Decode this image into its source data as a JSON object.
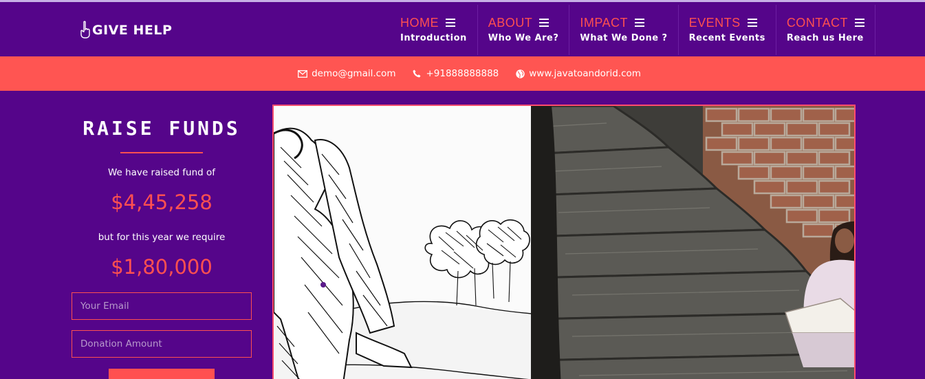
{
  "brand": {
    "name": "GIVE HELP",
    "icon": "hand-pointing-up-icon"
  },
  "nav": [
    {
      "label": "HOME",
      "sub": "Introduction"
    },
    {
      "label": "ABOUT",
      "sub": "Who We Are?"
    },
    {
      "label": "IMPACT",
      "sub": "What We Done ?"
    },
    {
      "label": "EVENTS",
      "sub": "Recent Events"
    },
    {
      "label": "CONTACT",
      "sub": "Reach us Here"
    }
  ],
  "contact": {
    "email": "demo@gmail.com",
    "phone": "+91888888888",
    "website": "www.javatoandorid.com"
  },
  "funds": {
    "title": "RAISE FUNDS",
    "raised_text": "We have raised fund of",
    "raised_amount": "$4,45,258",
    "require_text": "but for this year we require",
    "require_amount": "$1,80,000",
    "email_placeholder": "Your Email",
    "amount_placeholder": "Donation Amount"
  },
  "colors": {
    "background": "#55058a",
    "accent": "#ff5050",
    "infobar": "#ff5552"
  }
}
